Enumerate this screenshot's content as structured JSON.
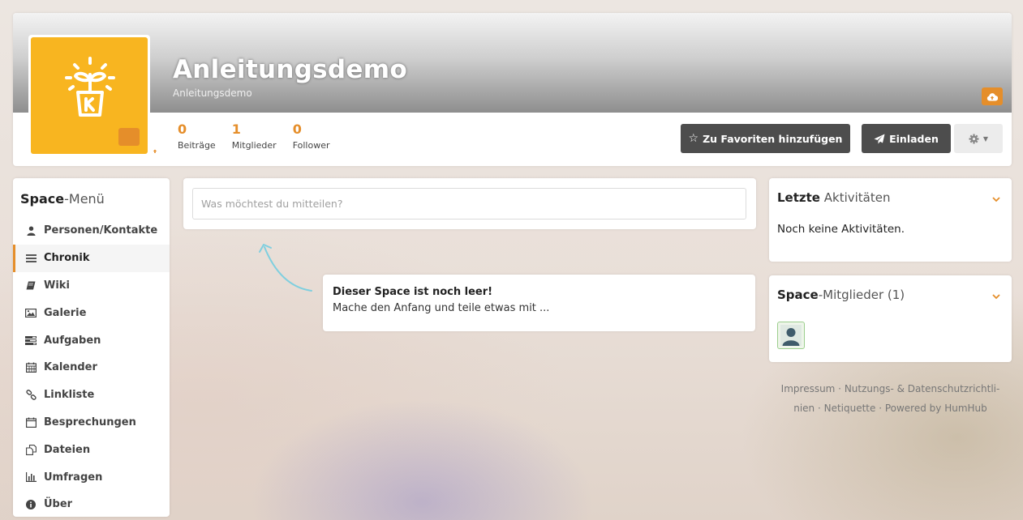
{
  "header": {
    "title": "Anleitungsdemo",
    "subtitle": "Anleitungsdemo",
    "stats": [
      {
        "value": "0",
        "label": "Beiträge"
      },
      {
        "value": "1",
        "label": "Mitglieder"
      },
      {
        "value": "0",
        "label": "Follower"
      }
    ],
    "favorite_label": "Zu Favoriten hinzufügen",
    "invite_label": "Einladen"
  },
  "menu": {
    "title_bold": "Space",
    "title_rest": "-Menü",
    "items": [
      {
        "label": "Personen/Kontakte",
        "icon": "user-icon"
      },
      {
        "label": "Chronik",
        "icon": "list-icon"
      },
      {
        "label": "Wiki",
        "icon": "book-icon"
      },
      {
        "label": "Galerie",
        "icon": "image-icon"
      },
      {
        "label": "Aufgaben",
        "icon": "tasks-icon"
      },
      {
        "label": "Kalender",
        "icon": "calendar-icon"
      },
      {
        "label": "Linkliste",
        "icon": "link-icon"
      },
      {
        "label": "Besprechungen",
        "icon": "calendar-blank-icon"
      },
      {
        "label": "Dateien",
        "icon": "files-icon"
      },
      {
        "label": "Umfragen",
        "icon": "bar-chart-icon"
      },
      {
        "label": "Über",
        "icon": "info-icon"
      }
    ]
  },
  "post": {
    "placeholder": "Was möchtest du mitteilen?"
  },
  "empty_state": {
    "title": "Dieser Space ist noch leer!",
    "text": "Mache den Anfang und teile etwas mit ..."
  },
  "activities": {
    "title_bold": "Letzte",
    "title_rest": " Aktivitäten",
    "empty": "Noch keine Aktivitäten."
  },
  "members": {
    "title_bold": "Space",
    "title_rest": "-Mitglieder (1)"
  },
  "footer": {
    "line1": "Impressum · Nutzungs- & Datenschutzrichtli-",
    "line2": "nien · Netiquette · Powered by HumHub"
  },
  "colors": {
    "accent": "#e58e2a",
    "avatar_bg": "#f8b520",
    "button_dark": "#4d4d4d"
  }
}
